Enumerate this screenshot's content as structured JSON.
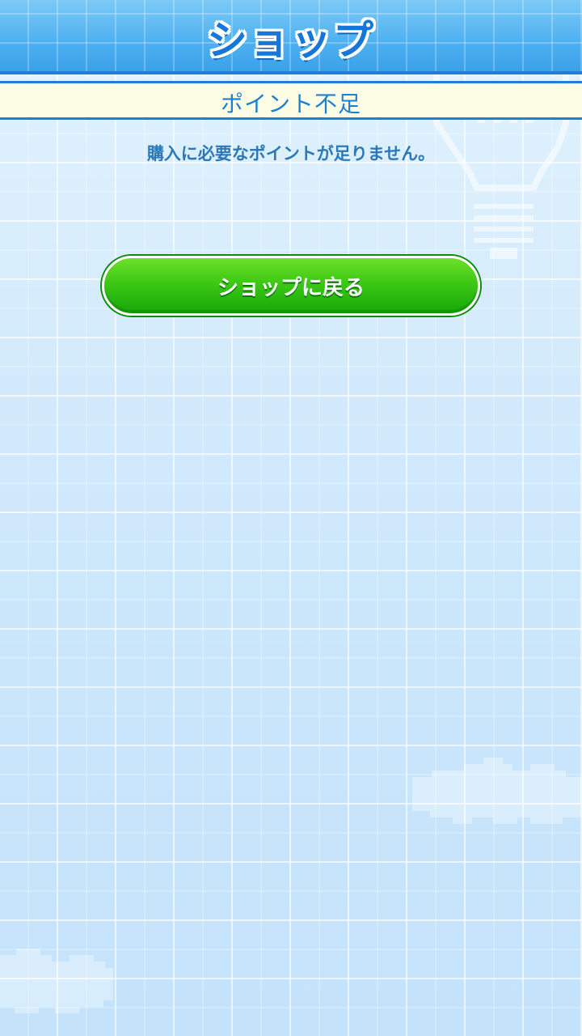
{
  "header": {
    "title": "ショップ"
  },
  "notice": {
    "title": "ポイント不足",
    "message": "購入に必要なポイントが足りません。"
  },
  "actions": {
    "back_label": "ショップに戻る"
  },
  "colors": {
    "header_blue": "#4eb0f0",
    "accent_blue": "#1e7fd6",
    "band_cream": "#fdfde6",
    "button_green": "#3cc814"
  },
  "decorations": [
    "lightbulb-icon",
    "cloud-icon",
    "cloud-icon"
  ]
}
